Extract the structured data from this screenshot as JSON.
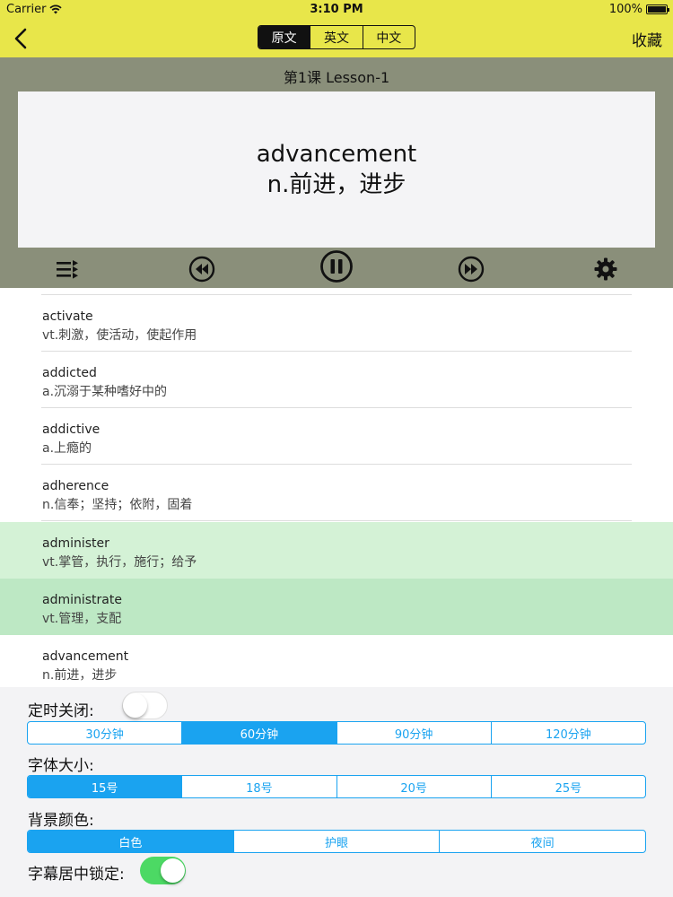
{
  "status": {
    "carrier": "Carrier",
    "time": "3:10 PM",
    "battery": "100%",
    "battery_level": 1.0
  },
  "nav": {
    "tabs": [
      {
        "label": "原文",
        "active": true
      },
      {
        "label": "英文",
        "active": false
      },
      {
        "label": "中文",
        "active": false
      }
    ],
    "favorite_label": "收藏"
  },
  "player": {
    "lesson_title": "第1课  Lesson-1",
    "current_word": "advancement",
    "current_meaning": "n.前进，进步",
    "controls": [
      "playlist-icon",
      "previous-icon",
      "pause-icon",
      "next-icon",
      "gear-icon"
    ]
  },
  "words": [
    {
      "en": "activate",
      "zh": "vt.刺激，使活动，使起作用",
      "highlight": ""
    },
    {
      "en": "addicted",
      "zh": "a.沉溺于某种嗜好中的",
      "highlight": ""
    },
    {
      "en": "addictive",
      "zh": "a.上瘾的",
      "highlight": ""
    },
    {
      "en": "adherence",
      "zh": "n.信奉；坚持；依附，固着",
      "highlight": ""
    },
    {
      "en": "administer",
      "zh": "vt.掌管，执行，施行；给予",
      "highlight": "#d4f2d6"
    },
    {
      "en": "administrate",
      "zh": "vt.管理，支配",
      "highlight": "#bde8c4"
    },
    {
      "en": "advancement",
      "zh": "n.前进，进步",
      "highlight": ""
    }
  ],
  "settings": {
    "timer_label": "定时关闭:",
    "timer_enabled": false,
    "timer_options": [
      "30分钟",
      "60分钟",
      "90分钟",
      "120分钟"
    ],
    "timer_selected": 1,
    "font_label": "字体大小:",
    "font_options": [
      "15号",
      "18号",
      "20号",
      "25号"
    ],
    "font_selected": 0,
    "bg_label": "背景颜色:",
    "bg_options": [
      "白色",
      "护眼",
      "夜间"
    ],
    "bg_selected": 0,
    "lock_label": "字幕居中锁定:",
    "lock_enabled": true
  },
  "colors": {
    "nav_bg": "#e8e64a",
    "player_bg": "#8a8f7a",
    "accent": "#1aa3f0",
    "toggle_on": "#4cd964"
  }
}
